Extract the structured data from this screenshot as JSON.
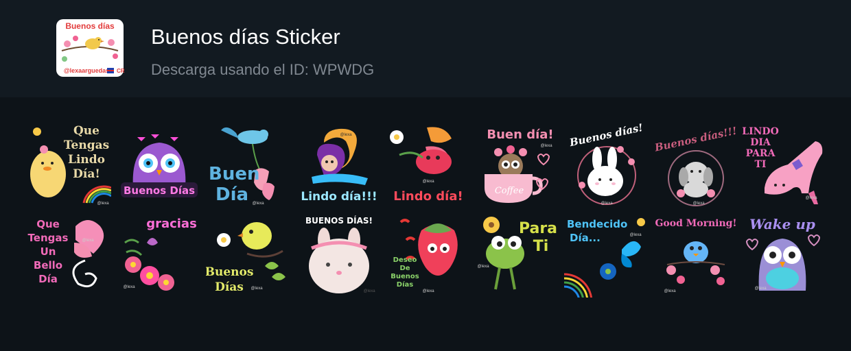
{
  "pack": {
    "title": "Buenos días Sticker",
    "subtitle": "Descarga usando el ID: WPWDG",
    "thumb_text_top": "Buenos días",
    "thumb_text_bottom": "@lexaarguedas",
    "thumb_flag_text": "CR"
  },
  "stickers": [
    {
      "lines": [
        "Que",
        "Tengas",
        "Lindo",
        "Día!"
      ],
      "tag": "@lexa",
      "icon": "duckling-icon"
    },
    {
      "lines": [
        "Buenos Días"
      ],
      "tag": "",
      "icon": "owl-icon"
    },
    {
      "lines": [
        "Buen",
        "Día"
      ],
      "tag": "@lexa",
      "icon": "bird-flower-icon"
    },
    {
      "lines": [
        "Lindo día!!!"
      ],
      "tag": "@lexa",
      "icon": "mermaid-icon"
    },
    {
      "lines": [
        "Lindo día!"
      ],
      "tag": "@lexa",
      "icon": "butterfly-fairy-icon"
    },
    {
      "lines": [
        "Buen día!"
      ],
      "tag": "@lexa",
      "icon": "owl-coffee-cup-icon",
      "extra": "Coffee"
    },
    {
      "lines": [
        "Buenos días!"
      ],
      "tag": "@lexa",
      "icon": "bunny-icon"
    },
    {
      "lines": [
        "Buenos días!!!"
      ],
      "tag": "@lexa",
      "icon": "puppy-icon"
    },
    {
      "lines": [
        "LINDO",
        "DIA",
        "PARA",
        "TI"
      ],
      "tag": "@lexa",
      "icon": "high-heel-shoe-icon"
    },
    {
      "lines": [
        "Que",
        "Tengas",
        "Un",
        "Bello",
        "Día"
      ],
      "tag": "@lexa",
      "icon": "heart-butterfly-icon"
    },
    {
      "lines": [
        "gracias"
      ],
      "tag": "@lexa",
      "icon": "flowers-icon"
    },
    {
      "lines": [
        "Buenos",
        "Días"
      ],
      "tag": "@lexa",
      "icon": "yellow-bird-icon"
    },
    {
      "lines": [
        "BUENOS DÍAS!"
      ],
      "tag": "@lexa",
      "icon": "bunny-face-icon"
    },
    {
      "lines": [
        "Deseo",
        "De",
        "Buenos",
        "Días"
      ],
      "tag": "@lexa",
      "icon": "strawberry-icon"
    },
    {
      "lines": [
        "Para",
        "Ti"
      ],
      "tag": "@lexa",
      "icon": "frog-flower-icon"
    },
    {
      "lines": [
        "Bendecido",
        "Día..."
      ],
      "tag": "@lexa",
      "icon": "rainbow-butterfly-icon"
    },
    {
      "lines": [
        "Good Morning!"
      ],
      "tag": "@lexa",
      "icon": "bluebird-icon"
    },
    {
      "lines": [
        "Wake up"
      ],
      "tag": "@lexa",
      "icon": "owl-purple-icon"
    }
  ]
}
